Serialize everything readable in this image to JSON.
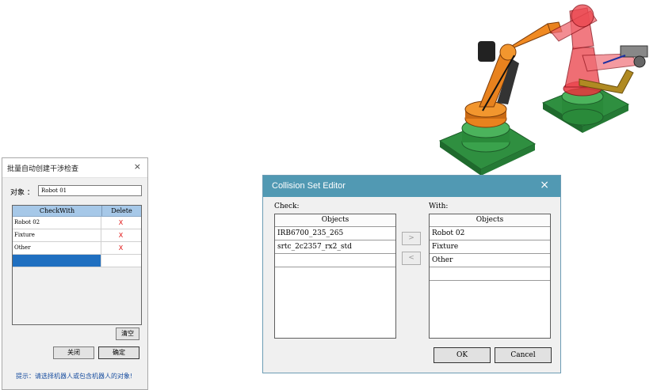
{
  "batch_dialog": {
    "title": "批量自动创建干涉检查",
    "close_glyph": "×",
    "object_label": "对象 ：",
    "object_value": "Robot 01",
    "grid": {
      "col_checkwith": "CheckWith",
      "col_delete": "Delete",
      "rows": [
        {
          "name": "Robot 02",
          "delete": "X"
        },
        {
          "name": "Fixture",
          "delete": "X"
        },
        {
          "name": "Other",
          "delete": "X"
        }
      ]
    },
    "clear_label": "清空",
    "close_label": "关闭",
    "ok_label": "确定",
    "hint": "提示：请选择机器人或包含机器人的对象!"
  },
  "collision_editor": {
    "title": "Collision Set Editor",
    "close_glyph": "×",
    "check_label": "Check:",
    "with_label": "With:",
    "objects_header": "Objects",
    "check_items": [
      "IRB6700_235_265",
      "srtc_2c2357_rx2_std"
    ],
    "with_items": [
      "Robot 02",
      "Fixture",
      "Other"
    ],
    "move_right": ">",
    "move_left": "<",
    "ok_label": "OK",
    "cancel_label": "Cancel"
  },
  "colors": {
    "editor_titlebar": "#5199b3",
    "grid_header": "#a6c8e8",
    "selection": "#1f6fc0",
    "delete_x": "#e01010",
    "hint_text": "#1a4fa0",
    "robot_orange": "#e8821e",
    "robot_red": "#e8323c",
    "base_green": "#2e8a3e"
  }
}
